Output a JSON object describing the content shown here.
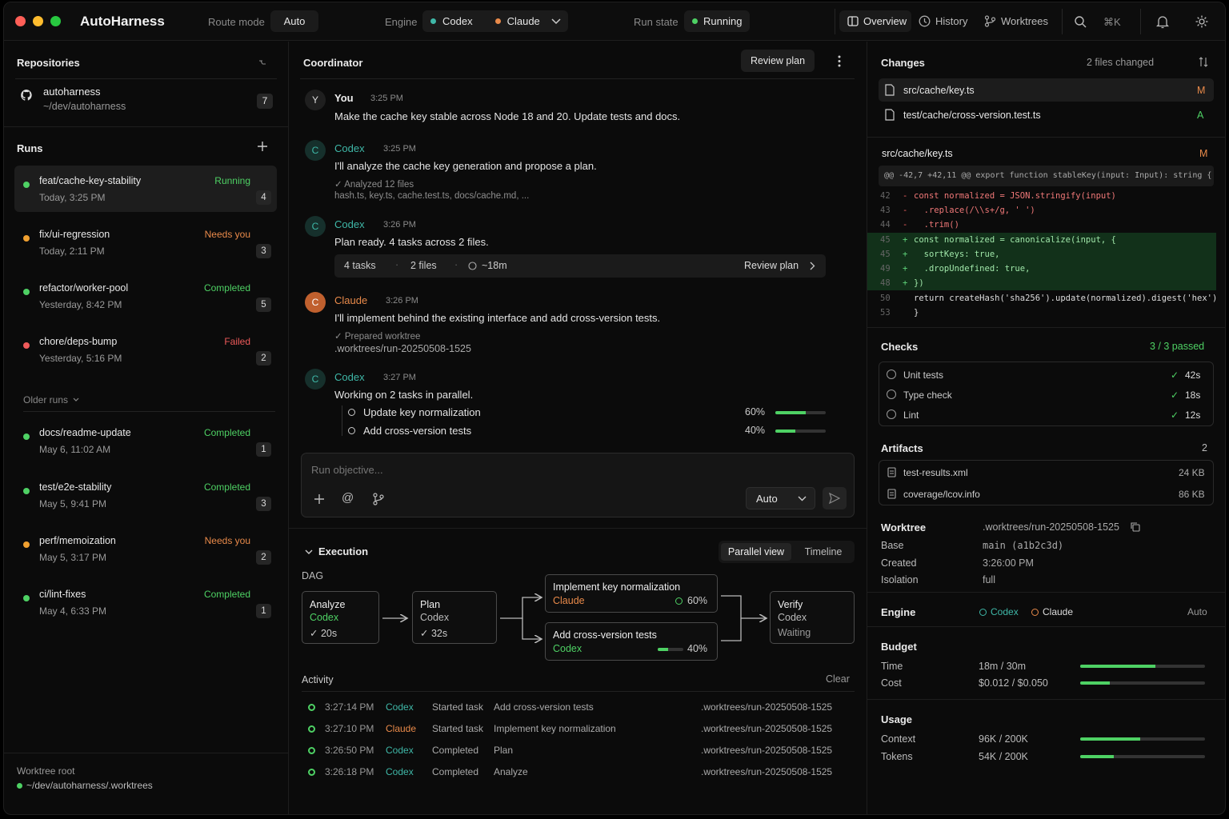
{
  "app": {
    "title": "AutoHarness"
  },
  "topbar": {
    "route_mode_label": "Route mode",
    "route_mode_value": "Auto",
    "engine_label": "Engine",
    "engine_codex": "Codex",
    "engine_claude": "Claude",
    "run_state_label": "Run state",
    "run_state_value": "Running",
    "nav_overview": "Overview",
    "nav_history": "History",
    "nav_worktrees": "Worktrees",
    "shortcut": "⌘K"
  },
  "sidebar": {
    "repositories_title": "Repositories",
    "repo_name": "autoharness",
    "repo_path": "~/dev/autoharness",
    "repo_count": "7",
    "runs_title": "Runs",
    "older_runs_label": "Older runs",
    "runs": [
      {
        "name": "feat/cache-key-stability",
        "time": "Today, 3:25 PM",
        "status": "Running",
        "count": "4"
      },
      {
        "name": "fix/ui-regression",
        "time": "Today, 2:11 PM",
        "status": "Needs you",
        "count": "3"
      },
      {
        "name": "refactor/worker-pool",
        "time": "Yesterday, 8:42 PM",
        "status": "Completed",
        "count": "5"
      },
      {
        "name": "chore/deps-bump",
        "time": "Yesterday, 5:16 PM",
        "status": "Failed",
        "count": "2"
      }
    ],
    "older_runs": [
      {
        "name": "docs/readme-update",
        "time": "May 6, 11:02 AM",
        "status": "Completed",
        "count": "1"
      },
      {
        "name": "test/e2e-stability",
        "time": "May 5, 9:41 PM",
        "status": "Completed",
        "count": "3"
      },
      {
        "name": "perf/memoization",
        "time": "May 5, 3:17 PM",
        "status": "Needs you",
        "count": "2"
      },
      {
        "name": "ci/lint-fixes",
        "time": "May 4, 6:33 PM",
        "status": "Completed",
        "count": "1"
      }
    ],
    "worktree_root_label": "Worktree root",
    "worktree_root_path": "~/dev/autoharness/.worktrees"
  },
  "coordinator": {
    "title": "Coordinator",
    "review_plan_button": "Review plan",
    "messages": [
      {
        "avatar": "Y",
        "author": "You",
        "time": "3:25 PM",
        "text": "Make the cache key stable across Node 18 and 20. Update tests and docs."
      },
      {
        "avatar": "C",
        "author": "Codex",
        "time": "3:25 PM",
        "text": "I'll analyze the cache key generation and propose a plan.",
        "sub1": "✓ Analyzed 12 files",
        "sub2": "hash.ts, key.ts, cache.test.ts, docs/cache.md, ..."
      },
      {
        "avatar": "C",
        "author": "Codex",
        "time": "3:26 PM",
        "text": "Plan ready. 4 tasks across 2 files."
      },
      {
        "avatar": "C",
        "author": "Claude",
        "time": "3:26 PM",
        "text": "I'll implement behind the existing interface and add cross-version tests.",
        "sub1": "✓ Prepared worktree",
        "sub2": ".worktrees/run-20250508-1525"
      },
      {
        "avatar": "C",
        "author": "Codex",
        "time": "3:27 PM",
        "text": "Working on 2 tasks in parallel."
      }
    ],
    "plan_summary": {
      "tasks": "4 tasks",
      "files": "2 files",
      "eta": "~18m",
      "action": "Review plan"
    },
    "tasks": [
      {
        "label": "Update key normalization",
        "percent": "60%",
        "progress": 0.6
      },
      {
        "label": "Add cross-version tests",
        "percent": "40%",
        "progress": 0.4
      }
    ],
    "input_placeholder": "Run objective...",
    "mode_select": "Auto"
  },
  "execution": {
    "title": "Execution",
    "view_parallel": "Parallel view",
    "view_timeline": "Timeline",
    "dag_label": "DAG",
    "nodes": {
      "analyze": {
        "title": "Analyze",
        "engine": "Codex",
        "meta": "✓ 20s"
      },
      "plan": {
        "title": "Plan",
        "engine": "Codex",
        "meta": "✓ 32s"
      },
      "implement": {
        "title": "Implement key normalization",
        "engine": "Claude",
        "meta": "60%"
      },
      "tests": {
        "title": "Add cross-version tests",
        "engine": "Codex",
        "meta": "40%",
        "progress": 0.4
      },
      "verify": {
        "title": "Verify",
        "engine": "Codex",
        "meta": "Waiting"
      }
    },
    "activity_title": "Activity",
    "clear_label": "Clear",
    "activity": [
      {
        "time": "3:27:14 PM",
        "engine": "Codex",
        "action": "Started task",
        "target": "Add cross-version tests",
        "path": ".worktrees/run-20250508-1525"
      },
      {
        "time": "3:27:10 PM",
        "engine": "Claude",
        "action": "Started task",
        "target": "Implement key normalization",
        "path": ".worktrees/run-20250508-1525"
      },
      {
        "time": "3:26:50 PM",
        "engine": "Codex",
        "action": "Completed",
        "target": "Plan",
        "path": ".worktrees/run-20250508-1525"
      },
      {
        "time": "3:26:18 PM",
        "engine": "Codex",
        "action": "Completed",
        "target": "Analyze",
        "path": ".worktrees/run-20250508-1525"
      }
    ]
  },
  "changes": {
    "title": "Changes",
    "count_label": "2 files changed",
    "files": [
      {
        "path": "src/cache/key.ts",
        "status": "M"
      },
      {
        "path": "test/cache/cross-version.test.ts",
        "status": "A"
      }
    ],
    "diff_file": "src/cache/key.ts",
    "diff_status": "M",
    "hunk": "@@ -42,7 +42,11 @@ export function stableKey(input: Input): string {",
    "lines": [
      {
        "n": "42",
        "s": "-",
        "c": "const normalized = JSON.stringify(input)"
      },
      {
        "n": "43",
        "s": "-",
        "c": "  .replace(/\\\\s+/g, ' ')"
      },
      {
        "n": "44",
        "s": "-",
        "c": "  .trim()"
      },
      {
        "n": "45",
        "s": "+",
        "c": "const normalized = canonicalize(input, {"
      },
      {
        "n": "45",
        "s": "+",
        "c": "  sortKeys: true,"
      },
      {
        "n": "49",
        "s": "+",
        "c": "  .dropUndefined: true,"
      },
      {
        "n": "48",
        "s": "+",
        "c": "})"
      },
      {
        "n": "50",
        "s": " ",
        "c": "return createHash('sha256').update(normalized).digest('hex')"
      },
      {
        "n": "53",
        "s": " ",
        "c": "}"
      }
    ]
  },
  "checks": {
    "title": "Checks",
    "summary": "3 / 3 passed",
    "items": [
      {
        "name": "Unit tests",
        "time": "42s"
      },
      {
        "name": "Type check",
        "time": "18s"
      },
      {
        "name": "Lint",
        "time": "12s"
      }
    ]
  },
  "artifacts": {
    "title": "Artifacts",
    "count": "2",
    "items": [
      {
        "name": "test-results.xml",
        "size": "24 KB"
      },
      {
        "name": "coverage/lcov.info",
        "size": "86 KB"
      }
    ]
  },
  "worktree": {
    "title": "Worktree",
    "path": ".worktrees/run-20250508-1525",
    "base_label": "Base",
    "base_value": "main (a1b2c3d)",
    "created_label": "Created",
    "created_value": "3:26:00 PM",
    "isolation_label": "Isolation",
    "isolation_value": "full"
  },
  "engine_info": {
    "title": "Engine",
    "codex": "Codex",
    "claude": "Claude",
    "mode": "Auto"
  },
  "budget": {
    "title": "Budget",
    "time_label": "Time",
    "time_value": "18m / 30m",
    "time_fraction": 0.6,
    "cost_label": "Cost",
    "cost_value": "$0.012 / $0.050",
    "cost_fraction": 0.24
  },
  "usage": {
    "title": "Usage",
    "context_label": "Context",
    "context_value": "96K / 200K",
    "context_fraction": 0.48,
    "tokens_label": "Tokens",
    "tokens_value": "54K / 200K",
    "tokens_fraction": 0.27
  },
  "colors": {
    "accent_green": "#4ed164",
    "codex_teal": "#3fb8a8",
    "claude_orange": "#e98a4a",
    "failed_red": "#ef5a5a",
    "background": "#0b0b0b"
  }
}
